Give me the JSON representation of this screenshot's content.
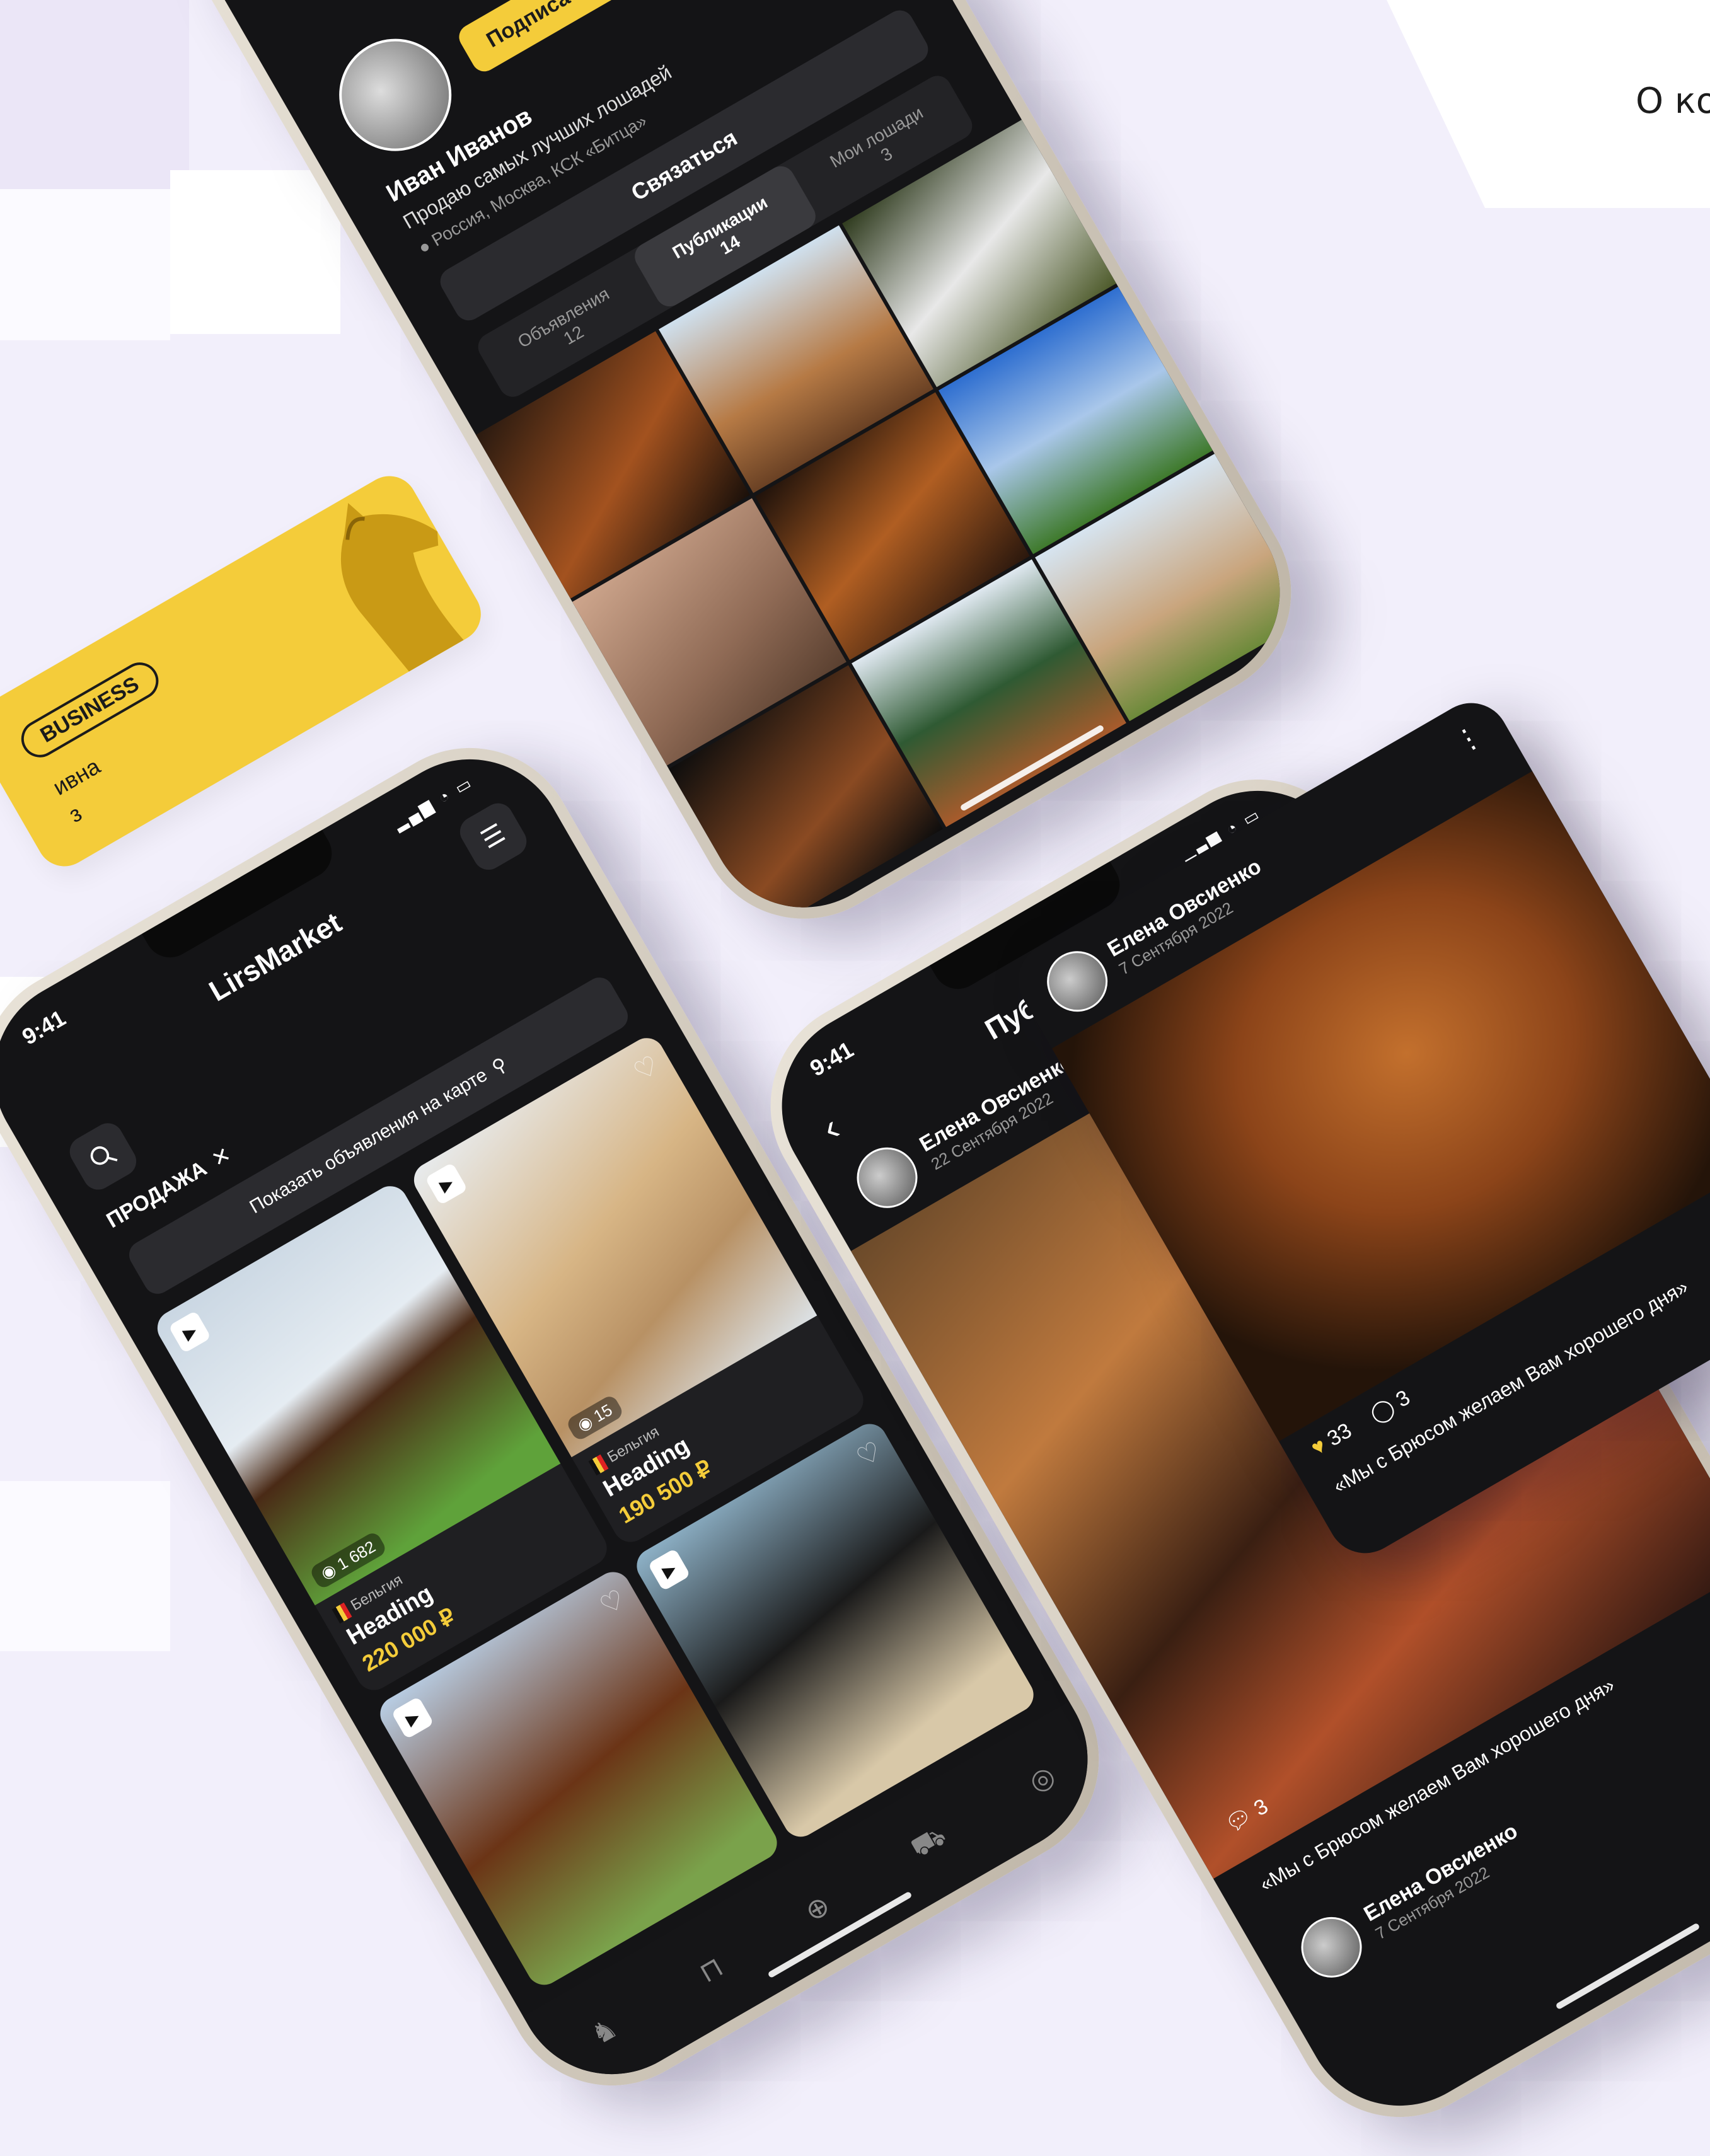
{
  "corner_text": "О ко",
  "business_card": {
    "badge": "BUSINESS",
    "line1": "ивна",
    "line2": "з"
  },
  "profile_phone": {
    "follow_button": "Подписаться",
    "name": "Иван Иванов",
    "bio": "Продаю самых лучших лошадей",
    "location": "Россия, Москва, КСК «Битца»",
    "contact_button": "Связаться",
    "tabs": [
      {
        "label": "Объявления",
        "count": "12"
      },
      {
        "label": "Публикации",
        "count": "14"
      },
      {
        "label": "Мои лошади",
        "count": "3"
      }
    ]
  },
  "market_phone": {
    "time": "9:41",
    "title": "LirsMarket",
    "filter_chip": "ПРОДАЖА",
    "map_button": "Показать объявления на карте",
    "cards": [
      {
        "views": "1 682",
        "country": "Бельгия",
        "heading": "Heading",
        "price": "220 000 ₽"
      },
      {
        "views": "15",
        "country": "Бельгия",
        "heading": "Heading",
        "price": "190 500 ₽"
      },
      {
        "views": "",
        "country": "",
        "heading": "",
        "price": ""
      },
      {
        "views": "",
        "country": "",
        "heading": "",
        "price": ""
      }
    ]
  },
  "pubs_phone": {
    "time": "9:41",
    "title": "Публикации",
    "post1": {
      "author": "Елена Овсиенко",
      "date": "22 Сентября 2022",
      "comments": "3",
      "caption": "«Мы с Брюсом желаем Вам хорошего дня»"
    },
    "post2": {
      "author": "Елена Овсиенко",
      "date": "7 Сентября 2022"
    }
  },
  "float_card": {
    "author": "Елена Овсиенко",
    "date": "7 Сентября 2022",
    "likes": "33",
    "comments": "3",
    "caption": "«Мы с Брюсом желаем Вам хорошего дня»"
  },
  "colors": {
    "accent": "#f4cc3a",
    "background": "#f2effb",
    "screen": "#141416"
  }
}
